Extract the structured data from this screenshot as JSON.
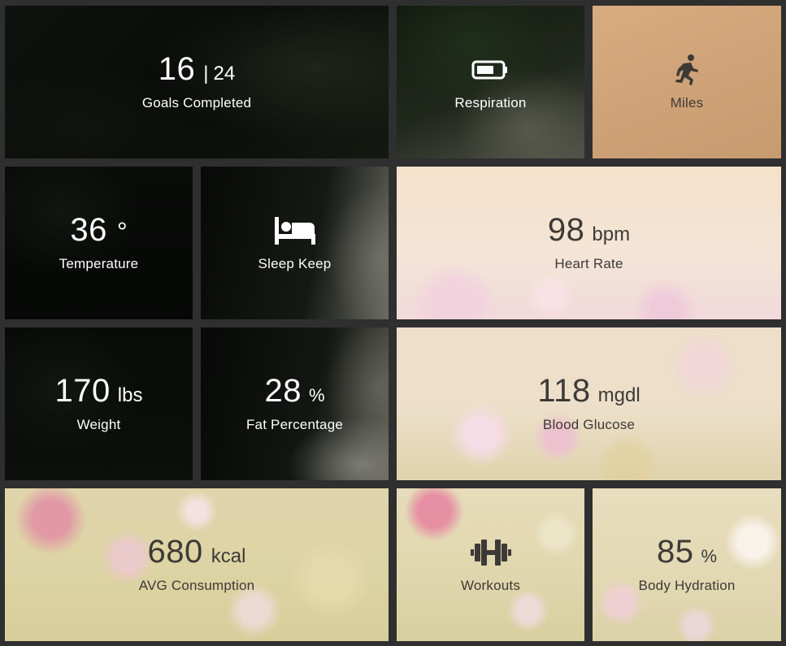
{
  "tiles": {
    "goals": {
      "value": "16",
      "separator": "|",
      "total": "24",
      "label": "Goals Completed"
    },
    "respiration": {
      "icon": "battery-icon",
      "label": "Respiration"
    },
    "miles": {
      "icon": "running-person-icon",
      "label": "Miles"
    },
    "temperature": {
      "value": "36",
      "unit": "°",
      "label": "Temperature"
    },
    "sleep": {
      "icon": "bed-icon",
      "label": "Sleep Keep"
    },
    "heart_rate": {
      "value": "98",
      "unit": "bpm",
      "label": "Heart Rate"
    },
    "weight": {
      "value": "170",
      "unit": "lbs",
      "label": "Weight"
    },
    "fat": {
      "value": "28",
      "unit": "%",
      "label": "Fat Percentage"
    },
    "glucose": {
      "value": "118",
      "unit": "mgdl",
      "label": "Blood Glucose"
    },
    "consumption": {
      "value": "680",
      "unit": "kcal",
      "label": "AVG Consumption"
    },
    "workouts": {
      "icon": "dumbbell-icon",
      "label": "Workouts"
    },
    "hydration": {
      "value": "85",
      "unit": "%",
      "label": "Body Hydration"
    }
  },
  "colors": {
    "gutter": "#2f2f2f",
    "text_light_on_dark": "#ffffff",
    "text_dark_on_light": "#3d3a36"
  }
}
